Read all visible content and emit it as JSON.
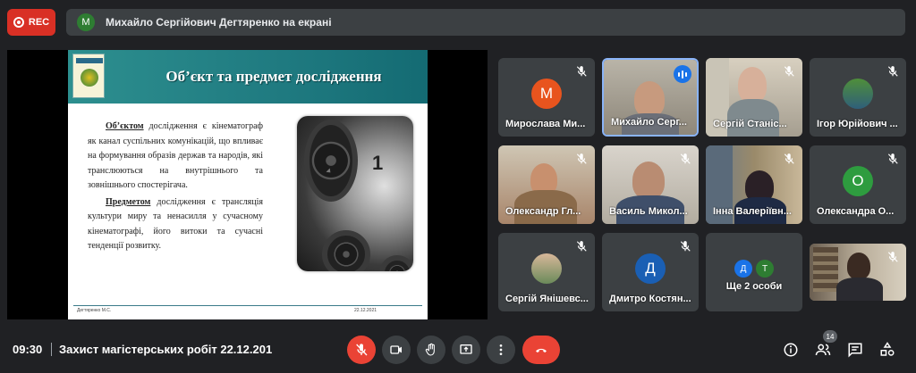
{
  "top": {
    "rec_label": "REC",
    "presenter_initial": "М",
    "presenting_text": "Михайло Сергійович Дегтяренко на екрані"
  },
  "slide": {
    "title": "Об’єкт та предмет дослідження",
    "object_term": "Об’єктом",
    "object_text": " дослідження є кінематограф як канал суспільних комунікацій, що впливає на формування образів держав та народів, які транслюються на внутрішнього та зовнішнього спостерігача.",
    "subject_term": "Предметом",
    "subject_text": " дослідження є трансляція культури миру та ненасилля у сучасному кінематографі, його витоки та сучасні тенденції розвитку.",
    "photo_number": "1",
    "footer_author": "Дегтяренко М.С.",
    "footer_date": "22.12.2021"
  },
  "participants": [
    {
      "name": "Мирослава Ми...",
      "initial": "М",
      "color": "#e8541e"
    },
    {
      "name": "Михайло Серг..."
    },
    {
      "name": "Сергій Станіс..."
    },
    {
      "name": "Ігор Юрійович ..."
    },
    {
      "name": "Олександр Гл..."
    },
    {
      "name": "Василь Микол..."
    },
    {
      "name": "Інна Валеріївн..."
    },
    {
      "name": "Олександра О...",
      "initial": "О",
      "color": "#2e9c3f"
    },
    {
      "name": "Сергій Янішевс..."
    },
    {
      "name": "Дмитро Костян...",
      "initial": "Д",
      "color": "#1a5fb4"
    },
    {
      "name": "Ще 2 особи",
      "initials": [
        "Д",
        "Т"
      ],
      "colors": [
        "#1a73e8",
        "#2e7d32"
      ]
    },
    {
      "name": ""
    }
  ],
  "bottom": {
    "time": "09:30",
    "meeting_title": "Захист магістерських робіт 22.12.201",
    "participants_count": "14"
  }
}
